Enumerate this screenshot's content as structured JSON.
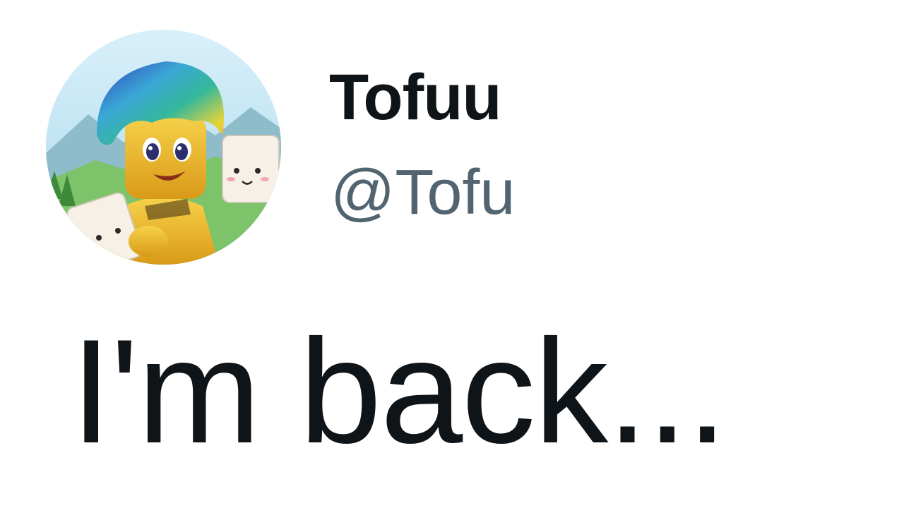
{
  "profile": {
    "display_name": "Tofuu",
    "handle": "@Tofu",
    "avatar": {
      "icon": "avatar-illustration",
      "colors": {
        "sky": "#bfe3f2",
        "mountains": "#8cbccc",
        "grass": "#6fae4a",
        "skin": "#f2c230",
        "hair_top": "#3a4fc9",
        "hair_mid": "#33b8a8",
        "hair_low": "#e7d23a"
      }
    }
  },
  "tweet": {
    "text": "I'm back..."
  },
  "colors": {
    "name": "#0f1419",
    "handle": "#536471",
    "body": "#0f1419",
    "background": "#ffffff"
  }
}
